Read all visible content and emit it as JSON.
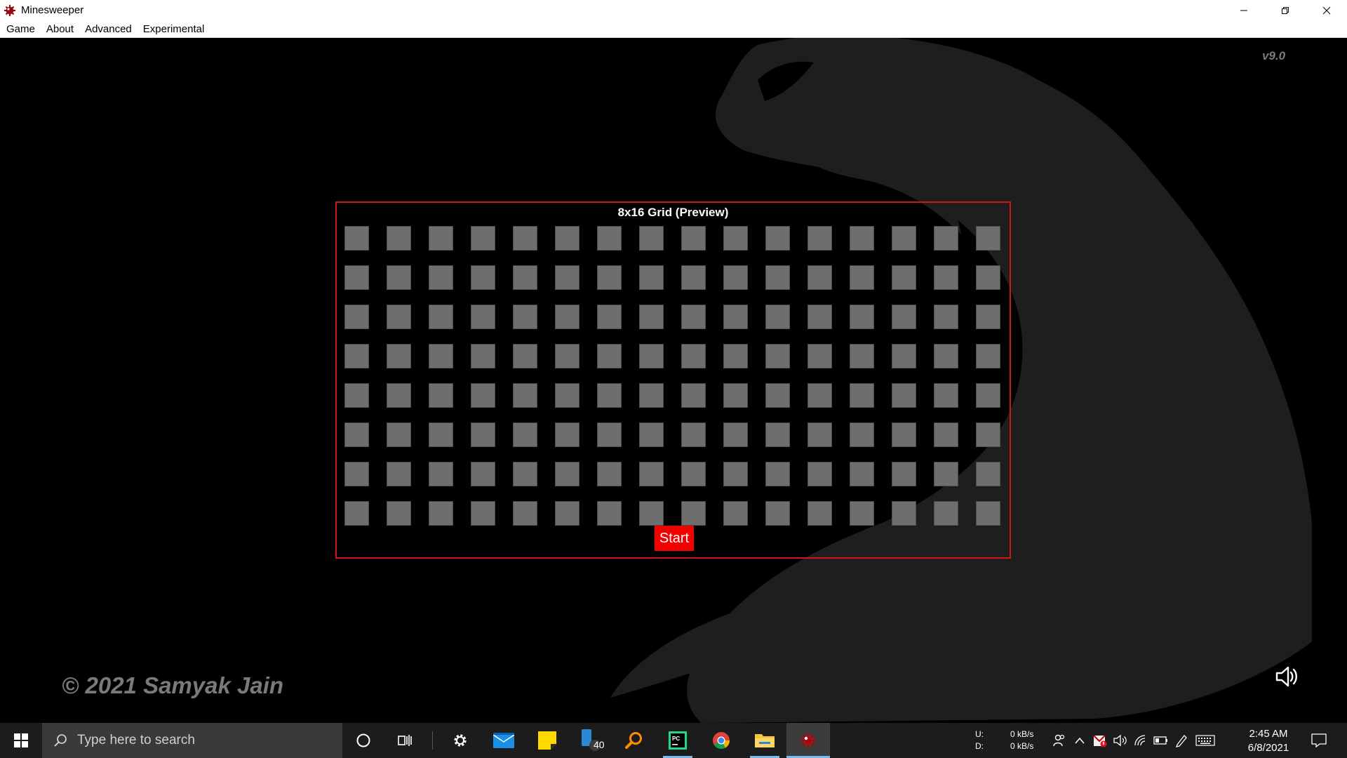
{
  "window": {
    "title": "Minesweeper",
    "controls": [
      "minimize",
      "restore",
      "close"
    ]
  },
  "menu": {
    "items": [
      "Game",
      "About",
      "Advanced",
      "Experimental"
    ]
  },
  "game": {
    "version": "v9.0",
    "grid_title": "8x16 Grid (Preview)",
    "rows": 8,
    "cols": 16,
    "start_label": "Start",
    "copyright": "© 2021 Samyak Jain",
    "sound_icon": "speaker-icon",
    "colors": {
      "accent": "#f40000",
      "panel_border": "#d4141b",
      "cell": "#6e6e6e"
    }
  },
  "taskbar": {
    "search_placeholder": "Type here to search",
    "pinned": [
      "cortana",
      "task-view",
      "settings",
      "mail",
      "sticky-notes",
      "phone",
      "search-everything",
      "pycharm",
      "chrome",
      "file-explorer",
      "minesweeper"
    ],
    "phone_badge": "40",
    "net_upload_label": "U:",
    "net_download_label": "D:",
    "net_upload_rate": "0 kB/s",
    "net_download_rate": "0 kB/s",
    "time": "2:45 AM",
    "date": "6/8/2021"
  }
}
